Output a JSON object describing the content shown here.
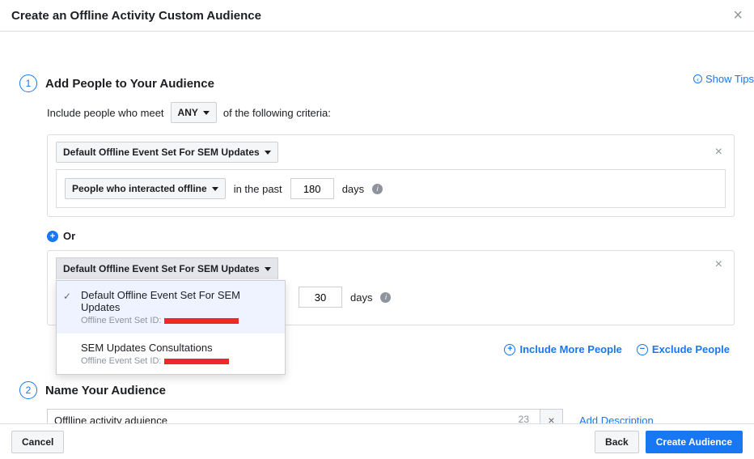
{
  "header": {
    "title": "Create an Offline Activity Custom Audience"
  },
  "tips": {
    "label": "Show Tips"
  },
  "section1": {
    "number": "1",
    "title": "Add People to Your Audience",
    "include_prefix": "Include people who meet",
    "any_label": "ANY",
    "include_suffix": "of the following criteria:",
    "rule1": {
      "event_set": "Default Offline Event Set For SEM Updates",
      "interaction": "People who interacted offline",
      "past_label": "in the past",
      "days_value": "180",
      "days_label": "days"
    },
    "or_label": "Or",
    "rule2": {
      "event_set_selected": "Default Offline Event Set For SEM Updates",
      "days_value": "30",
      "days_label": "days",
      "dropdown": [
        {
          "name": "Default Offline Event Set For SEM Updates",
          "sub_prefix": "Offline Event Set ID:",
          "selected": true
        },
        {
          "name": "SEM Updates Consultations",
          "sub_prefix": "Offline Event Set ID:",
          "selected": false
        }
      ]
    },
    "actions": {
      "include_more": "Include More People",
      "exclude": "Exclude People"
    }
  },
  "section2": {
    "number": "2",
    "title": "Name Your Audience",
    "name_value": "Offlline activity aduience",
    "char_count": "23",
    "add_description": "Add Description"
  },
  "footer": {
    "cancel": "Cancel",
    "back": "Back",
    "create": "Create Audience"
  }
}
